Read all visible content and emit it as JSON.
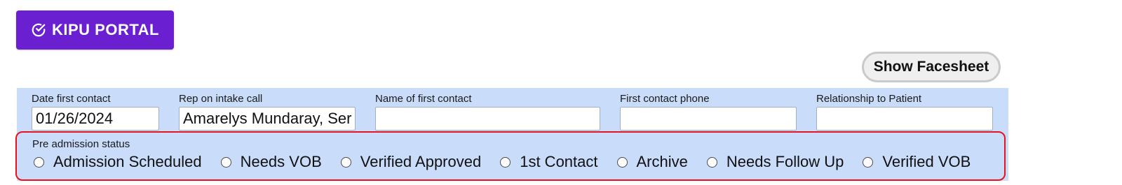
{
  "header": {
    "portal_button_label": "KIPU PORTAL",
    "facesheet_button_label": "Show Facesheet"
  },
  "fields": [
    {
      "label": "Date first contact",
      "value": ""
    },
    {
      "label": "Rep on intake call",
      "value": "01/26/2024"
    },
    {
      "label": "Name of first contact",
      "value": "Amarelys Mundaray, Ser"
    },
    {
      "label": "First contact phone",
      "value": ""
    },
    {
      "label": "Relationship to Patient",
      "value": ""
    }
  ],
  "status": {
    "label": "Pre admission status",
    "options": [
      "Admission Scheduled",
      "Needs VOB",
      "Verified Approved",
      "1st Contact",
      "Archive",
      "Needs Follow Up",
      "Verified VOB"
    ]
  },
  "colors": {
    "portal_button": "#6a1fd0",
    "panel_background": "#c9dcfa",
    "status_highlight_border": "#e8121c"
  }
}
